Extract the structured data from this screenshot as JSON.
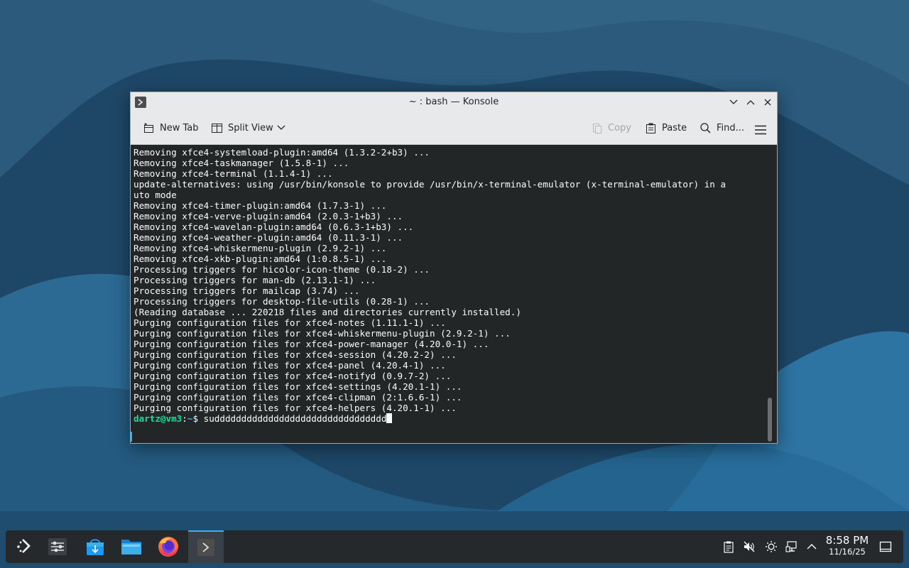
{
  "window": {
    "title": "~ : bash — Konsole"
  },
  "toolbar": {
    "new_tab": "New Tab",
    "split_view": "Split View",
    "copy": "Copy",
    "paste": "Paste",
    "find": "Find..."
  },
  "terminal": {
    "lines": [
      "Removing xfce4-systemload-plugin:amd64 (1.3.2-2+b3) ...",
      "Removing xfce4-taskmanager (1.5.8-1) ...",
      "Removing xfce4-terminal (1.1.4-1) ...",
      "update-alternatives: using /usr/bin/konsole to provide /usr/bin/x-terminal-emulator (x-terminal-emulator) in a",
      "uto mode",
      "Removing xfce4-timer-plugin:amd64 (1.7.3-1) ...",
      "Removing xfce4-verve-plugin:amd64 (2.0.3-1+b3) ...",
      "Removing xfce4-wavelan-plugin:amd64 (0.6.3-1+b3) ...",
      "Removing xfce4-weather-plugin:amd64 (0.11.3-1) ...",
      "Removing xfce4-whiskermenu-plugin (2.9.2-1) ...",
      "Removing xfce4-xkb-plugin:amd64 (1:0.8.5-1) ...",
      "Processing triggers for hicolor-icon-theme (0.18-2) ...",
      "Processing triggers for man-db (2.13.1-1) ...",
      "Processing triggers for mailcap (3.74) ...",
      "Processing triggers for desktop-file-utils (0.28-1) ...",
      "(Reading database ... 220218 files and directories currently installed.)",
      "Purging configuration files for xfce4-notes (1.11.1-1) ...",
      "Purging configuration files for xfce4-whiskermenu-plugin (2.9.2-1) ...",
      "Purging configuration files for xfce4-power-manager (4.20.0-1) ...",
      "Purging configuration files for xfce4-session (4.20.2-2) ...",
      "Purging configuration files for xfce4-panel (4.20.4-1) ...",
      "Purging configuration files for xfce4-notifyd (0.9.7-2) ...",
      "Purging configuration files for xfce4-settings (4.20.1-1) ...",
      "Purging configuration files for xfce4-clipman (2:1.6.6-1) ...",
      "Purging configuration files for xfce4-helpers (4.20.1-1) ..."
    ],
    "prompt_user": "dartz@vm3",
    "prompt_sep": ":",
    "prompt_path": "~",
    "prompt_symbol": "$ ",
    "command": "sudddddddddddddddddddddddddddddddd"
  },
  "taskbar": {
    "apps": [
      "application-launcher-icon",
      "system-settings-icon",
      "discover-icon",
      "dolphin-icon",
      "firefox-icon",
      "konsole-icon"
    ],
    "clock_time": "8:58 PM",
    "clock_date": "11/16/25"
  },
  "colors": {
    "terminal_bg": "#232627",
    "terminal_fg": "#fcfcfc",
    "prompt_user": "#1cdc9a",
    "prompt_path": "#3daee9",
    "accent": "#3daee9"
  }
}
